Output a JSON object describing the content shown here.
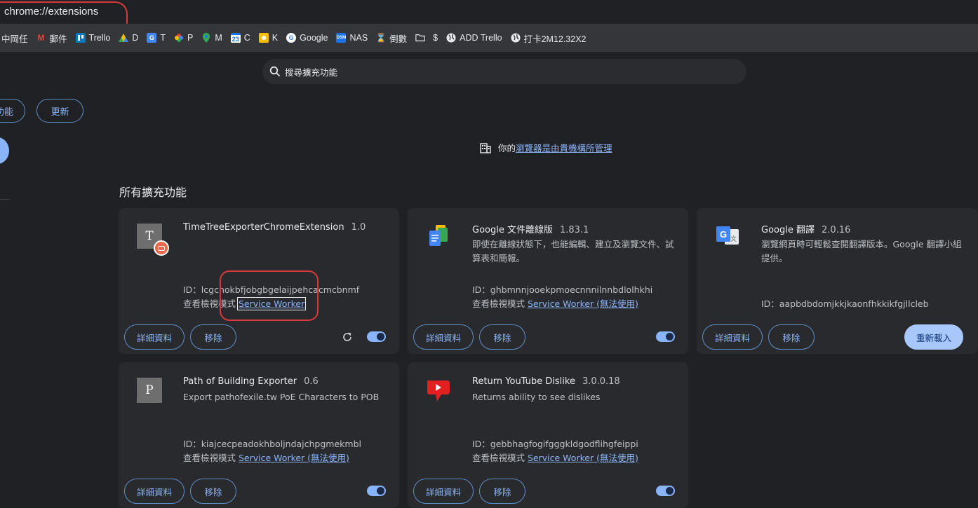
{
  "address_bar": {
    "url": "chrome://extensions"
  },
  "bookmarks": [
    {
      "label": "中岡任",
      "icon": "folder-icon"
    },
    {
      "label": "郵件",
      "icon": "gmail-icon"
    },
    {
      "label": "Trello",
      "icon": "trello-icon"
    },
    {
      "label": "D",
      "icon": "drive-icon"
    },
    {
      "label": "T",
      "icon": "translate-icon"
    },
    {
      "label": "P",
      "icon": "photos-icon"
    },
    {
      "label": "M",
      "icon": "maps-icon"
    },
    {
      "label": "C",
      "icon": "calendar-icon"
    },
    {
      "label": "K",
      "icon": "keep-icon"
    },
    {
      "label": "Google",
      "icon": "google-icon"
    },
    {
      "label": "NAS",
      "icon": "dsm-icon"
    },
    {
      "label": "倒數",
      "icon": "hourglass-icon"
    },
    {
      "label": "$",
      "icon": "folder-icon"
    },
    {
      "label": "ADD Trello",
      "icon": "globe-icon"
    },
    {
      "label": "打卡2M12.32X2",
      "icon": "globe-icon"
    }
  ],
  "search": {
    "placeholder": "搜尋擴充功能"
  },
  "toolbar": {
    "cut_label": "功能",
    "update_label": "更新"
  },
  "managed": {
    "prefix": "你的",
    "link": "瀏覽器是由貴機構所管理"
  },
  "section_title": "所有擴充功能",
  "common": {
    "details": "詳細資料",
    "remove": "移除",
    "inspect_prefix": "查看檢視模式",
    "reload": "重新載入"
  },
  "extensions": [
    {
      "name": "TimeTreeExporterChromeExtension",
      "version": "1.0",
      "description": "",
      "id": "ID：lcgchokbfjobgbgelaijpehcacmcbnmf",
      "inspect_link": "Service Worker",
      "enabled": true
    },
    {
      "name": "Google 文件離線版",
      "version": "1.83.1",
      "description": "即使在離線狀態下，也能編輯、建立及瀏覽文件、試算表和簡報。",
      "id": "ID：ghbmnnjooekpmoecnnnilnnbdlolhkhi",
      "inspect_link": "Service Worker (無法使用)",
      "enabled": true
    },
    {
      "name": "Google 翻譯",
      "version": "2.0.16",
      "description": "瀏覽網頁時可輕鬆查閱翻譯版本。Google 翻譯小組提供。",
      "id": "ID：aapbdbdomjkkjkaonfhkkikfgjllcleb",
      "inspect_link": "",
      "enabled": true
    },
    {
      "name": "Path of Building Exporter",
      "version": "0.6",
      "description": "Export pathofexile.tw PoE Characters to POB",
      "id": "ID：kiajcecpeadokhboljndajchpgmekmbl",
      "inspect_link": "Service Worker (無法使用)",
      "enabled": true
    },
    {
      "name": "Return YouTube Dislike",
      "version": "3.0.0.18",
      "description": "Returns ability to see dislikes",
      "id": "ID：gebbhagfogifgggkldgodflihgfeippi",
      "inspect_link": "Service Worker (無法使用)",
      "enabled": true
    }
  ],
  "icons": {
    "timetree_letter": "T",
    "pob_letter": "P"
  }
}
